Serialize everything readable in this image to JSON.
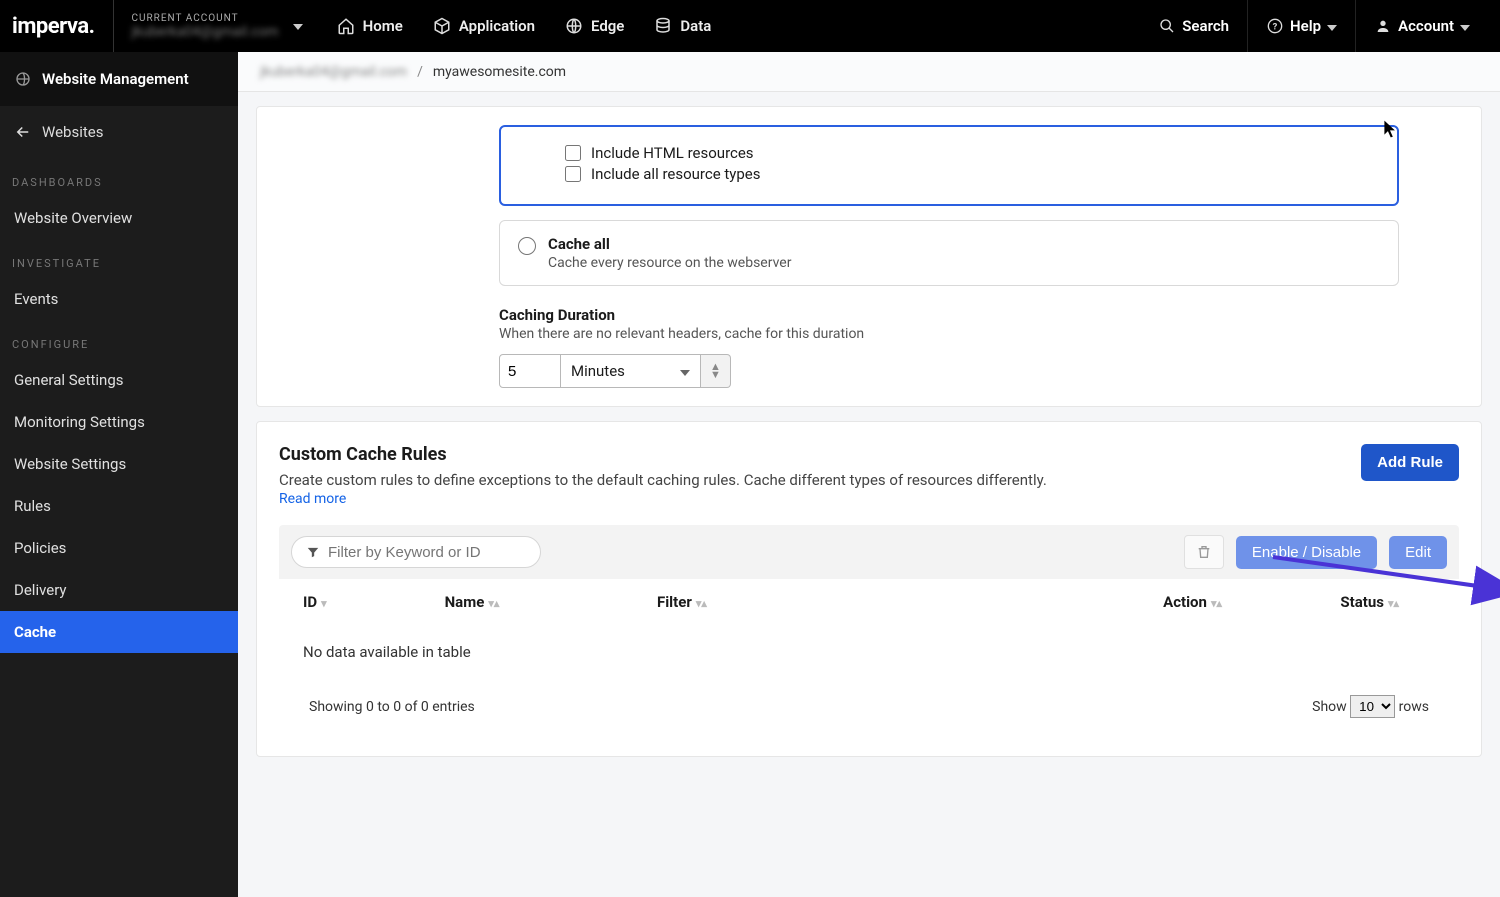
{
  "brand": "imperva",
  "account": {
    "label": "CURRENT ACCOUNT",
    "value": "jkuberka04@gmail.com"
  },
  "topnav": {
    "home": "Home",
    "application": "Application",
    "edge": "Edge",
    "data": "Data"
  },
  "topright": {
    "search": "Search",
    "help": "Help",
    "account": "Account"
  },
  "sidebar": {
    "title": "Website Management",
    "back": "Websites",
    "sec_dashboards": "DASHBOARDS",
    "overview": "Website Overview",
    "sec_investigate": "INVESTIGATE",
    "events": "Events",
    "sec_configure": "CONFIGURE",
    "general": "General Settings",
    "monitoring": "Monitoring Settings",
    "website": "Website Settings",
    "rules": "Rules",
    "policies": "Policies",
    "delivery": "Delivery",
    "cache": "Cache"
  },
  "breadcrumb": {
    "acct": "jkuberka04@gmail.com",
    "site": "myawesomesite.com"
  },
  "options": {
    "include_html": "Include HTML resources",
    "include_all": "Include all resource types",
    "cache_all_title": "Cache all",
    "cache_all_desc": "Cache every resource on the webserver"
  },
  "caching": {
    "title": "Caching Duration",
    "desc": "When there are no relevant headers, cache for this duration",
    "value": "5",
    "unit": "Minutes"
  },
  "customRules": {
    "heading": "Custom Cache Rules",
    "desc": "Create custom rules to define exceptions to the default caching rules. Cache different types of resources differently.",
    "readmore": "Read more",
    "addRule": "Add Rule",
    "filter_placeholder": "Filter by Keyword or ID",
    "enableDisable": "Enable / Disable",
    "edit": "Edit",
    "cols": {
      "id": "ID",
      "name": "Name",
      "filter": "Filter",
      "action": "Action",
      "status": "Status"
    },
    "empty": "No data available in table",
    "showing": "Showing 0 to 0 of 0 entries",
    "show": "Show",
    "rows": "rows",
    "pageSize": "10"
  }
}
